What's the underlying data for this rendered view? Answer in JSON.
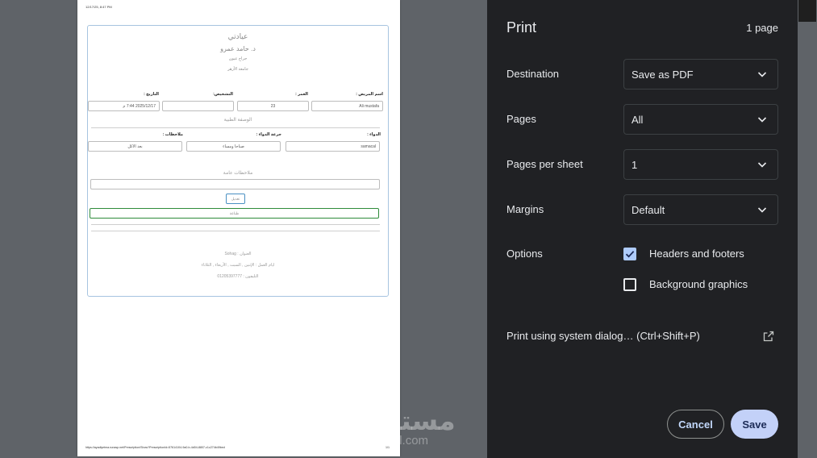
{
  "preview": {
    "header_date": "12/17/25, 8:47 PM",
    "footer_url": "https://ayadiyetma.runasp.net/Prescription/Show?PrescriptionId=57614104-9a0-b-4d04-8807-c1c274b49bed",
    "footer_page": "1/1",
    "clinic_name": "عيادتي",
    "doctor_name": "د. حامد عمرو",
    "specialty": "جراح عيون",
    "university": "جامعة الأزهر",
    "patient_label": "اسم المريض :",
    "patient_value": "Ali mustafa",
    "age_label": "العمر :",
    "age_value": "23",
    "diagnosis_label": "التشخيص:",
    "diagnosis_value": "",
    "date_label": "التاريخ :",
    "date_value": "2025/12/17 7:44 م",
    "rx_title": "الوصفة الطبية",
    "drug_label": "الدواء :",
    "drug_value": "samacal",
    "dose_label": "جرعة الدواء :",
    "dose_value": "صباحا ومساء",
    "notes_label": "ملاحظات :",
    "notes_value": "بعد الاكل",
    "general_notes_title": "ملاحظات عامة",
    "general_notes_value": "",
    "edit_button": "تعديل",
    "print_button": "طباعة",
    "address": "العنوان : Sohag",
    "work_days": "ايام العمل : الإثنين , السبت , الأربعاء , الثلاثاء",
    "phone": "التليفون : 01205397777"
  },
  "settings": {
    "title": "Print",
    "page_count": "1 page",
    "destination": {
      "label": "Destination",
      "value": "Save as PDF"
    },
    "pages": {
      "label": "Pages",
      "value": "All"
    },
    "pages_per_sheet": {
      "label": "Pages per sheet",
      "value": "1"
    },
    "margins": {
      "label": "Margins",
      "value": "Default"
    },
    "options": {
      "label": "Options",
      "headers_footers": {
        "label": "Headers and footers",
        "checked": true
      },
      "background_graphics": {
        "label": "Background graphics",
        "checked": false
      }
    },
    "system_dialog": "Print using system dialog… (Ctrl+Shift+P)",
    "cancel": "Cancel",
    "save": "Save"
  },
  "watermark": {
    "arabic": "مستقل",
    "latin": "mostaql.com"
  },
  "colors": {
    "panel_bg": "#202124",
    "accent": "#aecbfa",
    "save_bg": "#c3d1f8",
    "preview_bg": "#5f6368"
  },
  "icons": [
    "chevron-down-icon",
    "checkbox-checked-icon",
    "checkbox-unchecked-icon",
    "open-in-new-icon"
  ]
}
